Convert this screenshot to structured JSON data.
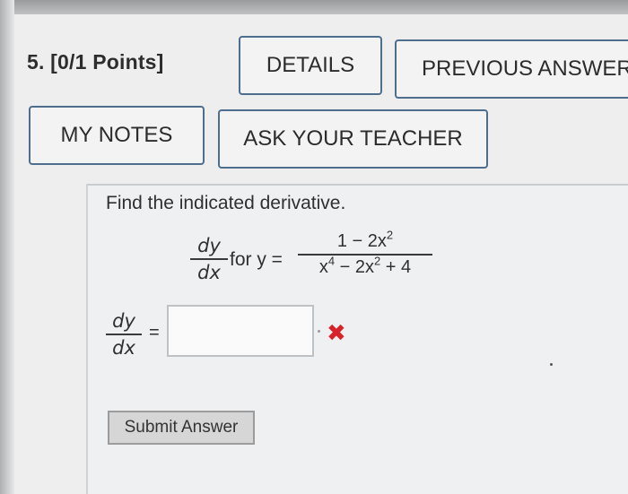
{
  "question": {
    "title": "5. [0/1 Points]"
  },
  "buttons": {
    "details": "DETAILS",
    "previous_answers": "PREVIOUS ANSWER",
    "my_notes": "MY NOTES",
    "ask_teacher": "ASK YOUR TEACHER"
  },
  "problem": {
    "prompt": "Find the indicated derivative.",
    "derivative_num": "dy",
    "derivative_den": "dx",
    "for_y": "for y =",
    "rhs_num_a": "1 − 2x",
    "rhs_num_exp": "2",
    "rhs_den_a": "x",
    "rhs_den_exp1": "4",
    "rhs_den_b": " − 2x",
    "rhs_den_exp2": "2",
    "rhs_den_c": " + 4"
  },
  "answer": {
    "lhs_num": "dy",
    "lhs_den": "dx",
    "equals": "=",
    "value": "",
    "status_icon": "wrong-x-icon",
    "status_color": "#d8222a"
  },
  "submit_label": "Submit Answer"
}
